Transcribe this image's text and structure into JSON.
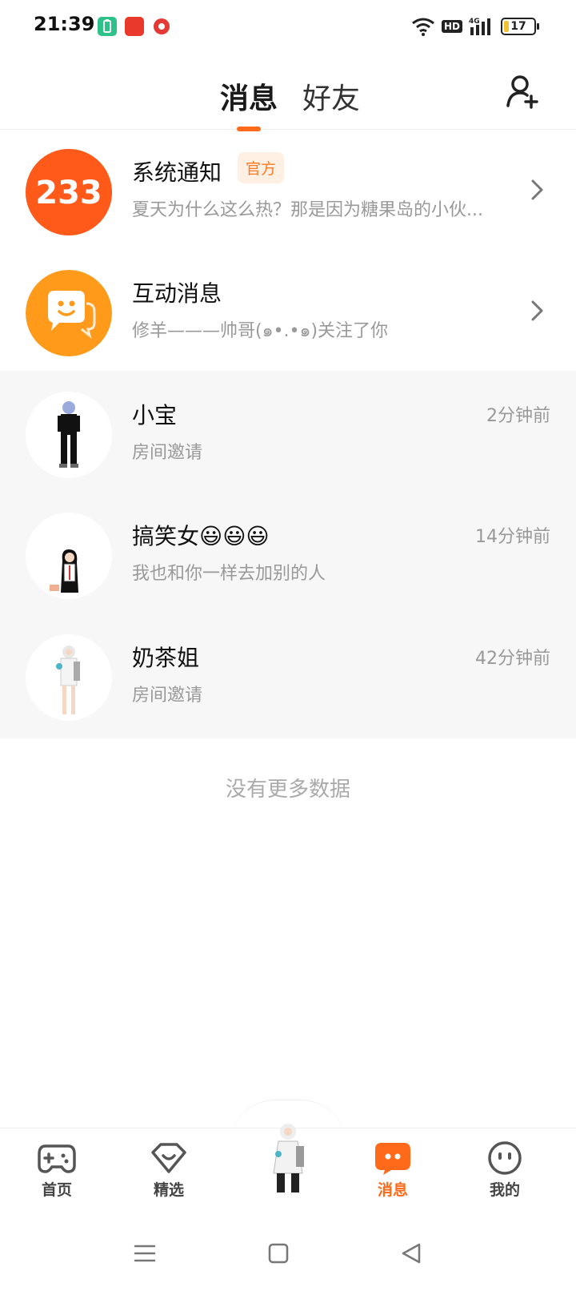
{
  "status_bar": {
    "time": "21:39",
    "network": "4G",
    "hd": "HD",
    "battery": "17",
    "battery_level": 0.17,
    "app_icons": [
      "battery-app-icon",
      "toutiao-icon",
      "red-app-icon"
    ]
  },
  "header": {
    "tabs": [
      {
        "label": "消息",
        "active": true
      },
      {
        "label": "好友",
        "active": false
      }
    ]
  },
  "system_items": [
    {
      "avatar_text": "233",
      "title": "系统通知",
      "badge": "官方",
      "subtitle": "夏天为什么这么热？那是因为糖果岛的小伙..."
    },
    {
      "title": "互动消息",
      "subtitle": "修羊———帅哥(๑•.•๑)关注了你"
    }
  ],
  "chats": [
    {
      "name": "小宝",
      "message": "房间邀请",
      "time": "2分钟前"
    },
    {
      "name": "搞笑女😃😃😃",
      "message": "我也和你一样去加别的人",
      "time": "14分钟前"
    },
    {
      "name": "奶茶姐",
      "message": "房间邀请",
      "time": "42分钟前"
    }
  ],
  "footer_text": "没有更多数据",
  "bottom_nav": [
    {
      "label": "首页",
      "icon": "gamepad-icon",
      "active": false
    },
    {
      "label": "精选",
      "icon": "heart-gem-icon",
      "active": false
    },
    {
      "label": "消息",
      "icon": "chat-bubble-icon",
      "active": true
    },
    {
      "label": "我的",
      "icon": "smiley-face-icon",
      "active": false
    }
  ],
  "colors": {
    "accent": "#ff6a1a",
    "badge_bg": "#fff0e3",
    "chat_row_bg": "#f7f7f7"
  }
}
